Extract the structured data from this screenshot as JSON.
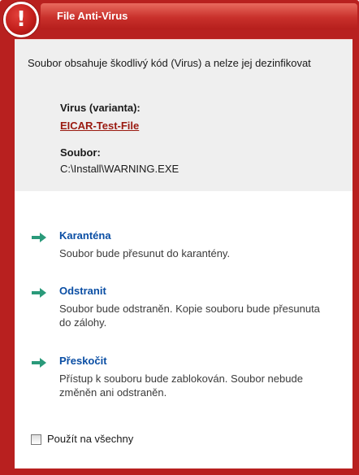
{
  "window": {
    "title": "File Anti-Virus"
  },
  "colors": {
    "frame": "#b8201f",
    "link": "#0a4ea4",
    "virus_link": "#9a1a10",
    "arrow": "#2a9a7a"
  },
  "warning_icon": {
    "icon": "exclamation-icon",
    "glyph": "!"
  },
  "message": "Soubor obsahuje škodlivý kód (Virus) a nelze jej dezinfikovat",
  "details": {
    "virus_label": "Virus (varianta):",
    "virus_name": "EICAR-Test-File",
    "file_label": "Soubor:",
    "file_path": "C:\\Install\\WARNING.EXE"
  },
  "actions": [
    {
      "label": "Karanténa",
      "description": "Soubor bude přesunut do karantény.",
      "icon": "arrow-right-icon"
    },
    {
      "label": "Odstranit",
      "description": "Soubor bude odstraněn. Kopie souboru bude přesunuta do zálohy.",
      "icon": "arrow-right-icon"
    },
    {
      "label": "Přeskočit",
      "description": "Přístup k souboru bude zablokován. Soubor nebude změněn ani odstraněn.",
      "icon": "arrow-right-icon"
    }
  ],
  "apply_all": {
    "label": "Použít na všechny",
    "checked": false
  }
}
